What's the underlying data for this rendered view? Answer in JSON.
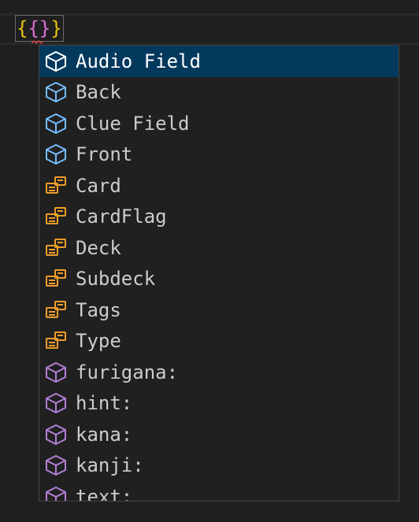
{
  "editor": {
    "code": {
      "open_outer": "{",
      "open_inner": "{",
      "close_inner": "}",
      "close_outer": "}"
    },
    "colors": {
      "background": "#1f1f1f",
      "brace_outer": "#e8c313",
      "brace_inner": "#da70d6",
      "squiggle": "#f14c4c"
    }
  },
  "suggest": {
    "selected_index": 0,
    "colors": {
      "selected_background": "#04395e",
      "field_icon": "#75beff",
      "keyword_icon": "#ee9d28",
      "variable_icon": "#b180d7",
      "selected_icon": "#ffffff"
    },
    "items": [
      {
        "label": "Audio Field",
        "kind": "field",
        "icon": "cube-icon"
      },
      {
        "label": "Back",
        "kind": "field",
        "icon": "cube-icon"
      },
      {
        "label": "Clue Field",
        "kind": "field",
        "icon": "cube-icon"
      },
      {
        "label": "Front",
        "kind": "field",
        "icon": "cube-icon"
      },
      {
        "label": "Card",
        "kind": "keyword",
        "icon": "snippet-icon"
      },
      {
        "label": "CardFlag",
        "kind": "keyword",
        "icon": "snippet-icon"
      },
      {
        "label": "Deck",
        "kind": "keyword",
        "icon": "snippet-icon"
      },
      {
        "label": "Subdeck",
        "kind": "keyword",
        "icon": "snippet-icon"
      },
      {
        "label": "Tags",
        "kind": "keyword",
        "icon": "snippet-icon"
      },
      {
        "label": "Type",
        "kind": "keyword",
        "icon": "snippet-icon"
      },
      {
        "label": "furigana:",
        "kind": "variable",
        "icon": "cube-icon"
      },
      {
        "label": "hint:",
        "kind": "variable",
        "icon": "cube-icon"
      },
      {
        "label": "kana:",
        "kind": "variable",
        "icon": "cube-icon"
      },
      {
        "label": "kanji:",
        "kind": "variable",
        "icon": "cube-icon"
      },
      {
        "label": "text:",
        "kind": "variable",
        "icon": "cube-icon"
      }
    ]
  }
}
